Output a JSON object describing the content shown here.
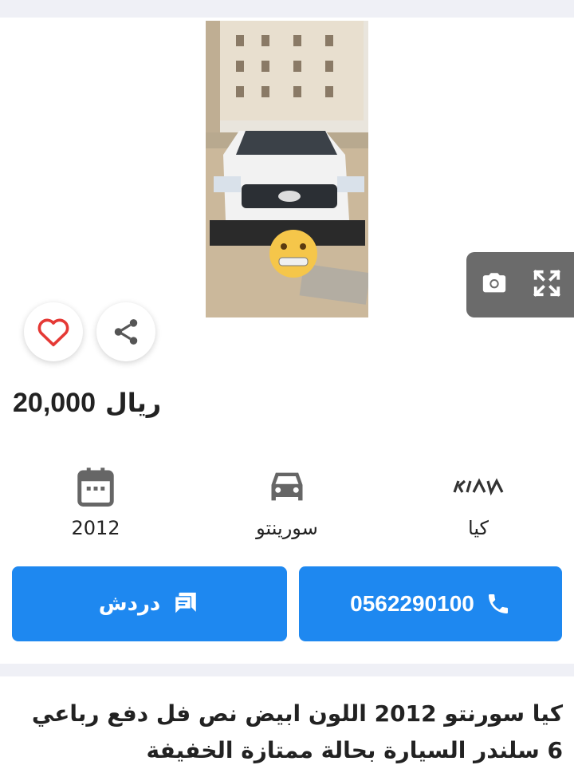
{
  "listing": {
    "price_value": "20,000",
    "price_currency": "ريال",
    "specs": {
      "make": "كيا",
      "model": "سورينتو",
      "year": "2012"
    },
    "buttons": {
      "call_number": "0562290100",
      "chat_label": "دردش"
    },
    "description": "كيا سورنتو 2012 اللون ابيض نص فل دفع رباعي 6 سلندر السيارة بحالة ممتازة الخفيفة"
  },
  "icons": {
    "favorite": "heart-outline-icon",
    "share": "share-icon",
    "camera": "camera-icon",
    "expand": "fullscreen-icon",
    "year": "calendar-icon",
    "model": "car-icon",
    "make": "kia-logo",
    "call": "phone-icon",
    "chat": "chat-icon"
  },
  "colors": {
    "accent": "#1e88f0",
    "heart": "#e53935",
    "media_pill": "#6b6b6b",
    "separator": "#eff0f6"
  }
}
